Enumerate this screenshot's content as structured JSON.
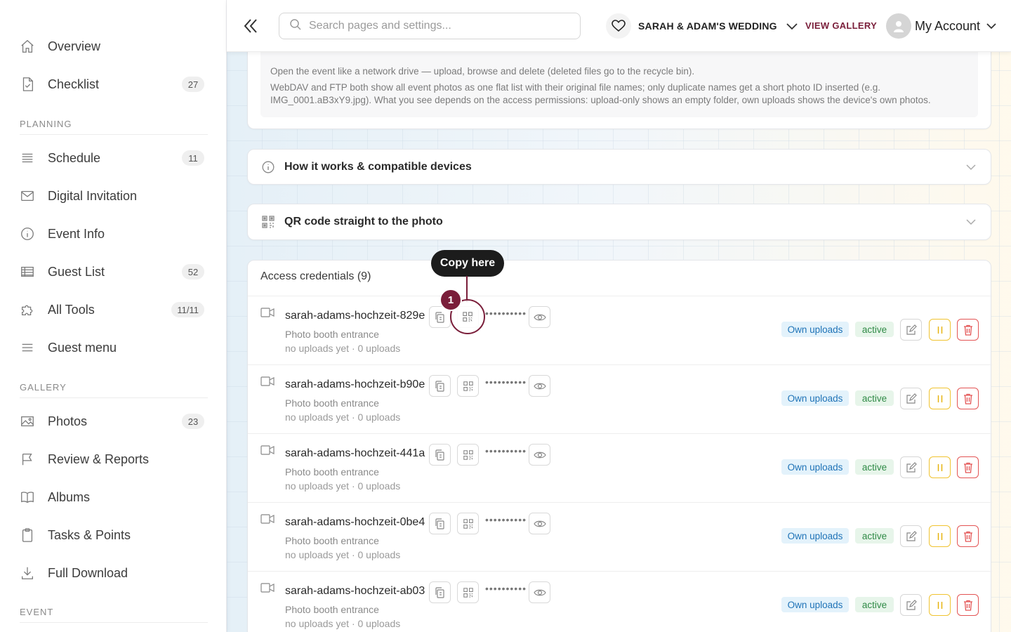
{
  "sidebar": {
    "items": [
      {
        "label": "Overview",
        "icon": "home-icon",
        "count": ""
      },
      {
        "label": "Checklist",
        "icon": "checklist-icon",
        "count": "27"
      },
      {
        "label": "Schedule",
        "icon": "schedule-icon",
        "count": "11"
      },
      {
        "label": "Digital Invitation",
        "icon": "envelope-icon",
        "count": ""
      },
      {
        "label": "Event Info",
        "icon": "info-icon",
        "count": ""
      },
      {
        "label": "Guest List",
        "icon": "table-icon",
        "count": "52"
      },
      {
        "label": "All Tools",
        "icon": "puzzle-icon",
        "count": "11/11"
      },
      {
        "label": "Guest menu",
        "icon": "menu-icon",
        "count": ""
      },
      {
        "label": "Photos",
        "icon": "image-icon",
        "count": "23"
      },
      {
        "label": "Review & Reports",
        "icon": "flag-icon",
        "count": ""
      },
      {
        "label": "Albums",
        "icon": "book-icon",
        "count": ""
      },
      {
        "label": "Tasks & Points",
        "icon": "clipboard-icon",
        "count": ""
      },
      {
        "label": "Full Download",
        "icon": "download-icon",
        "count": ""
      }
    ],
    "sections": {
      "planning": "PLANNING",
      "gallery": "GALLERY",
      "event": "EVENT"
    }
  },
  "topbar": {
    "search_placeholder": "Search pages and settings...",
    "event_name": "SARAH & ADAM'S WEDDING",
    "view_gallery": "VIEW GALLERY",
    "account_label": "My Account"
  },
  "network_drive": {
    "line1": "Open the event like a network drive — upload, browse and delete (deleted files go to the recycle bin).",
    "line2": "WebDAV and FTP both show all event photos as one flat list with their original file names; only duplicate names get a short photo ID inserted (e.g. IMG_0001.aB3xY9.jpg). What you see depends on the access permissions: upload-only shows an empty folder, own uploads shows the device's own photos."
  },
  "accordions": {
    "how_it_works": "How it works & compatible devices",
    "qr_code": "QR code straight to the photo"
  },
  "credentials": {
    "header": "Access credentials (9)",
    "rows": [
      {
        "name": "sarah-adams-hochzeit-829e",
        "location": "Photo booth entrance",
        "meta": "no uploads yet · 0 uploads",
        "password_mask": "••••••••••",
        "permission": "Own uploads",
        "status": "active"
      },
      {
        "name": "sarah-adams-hochzeit-b90e",
        "location": "Photo booth entrance",
        "meta": "no uploads yet · 0 uploads",
        "password_mask": "••••••••••",
        "permission": "Own uploads",
        "status": "active"
      },
      {
        "name": "sarah-adams-hochzeit-441a",
        "location": "Photo booth entrance",
        "meta": "no uploads yet · 0 uploads",
        "password_mask": "••••••••••",
        "permission": "Own uploads",
        "status": "active"
      },
      {
        "name": "sarah-adams-hochzeit-0be4",
        "location": "Photo booth entrance",
        "meta": "no uploads yet · 0 uploads",
        "password_mask": "••••••••••",
        "permission": "Own uploads",
        "status": "active"
      },
      {
        "name": "sarah-adams-hochzeit-ab03",
        "location": "Photo booth entrance",
        "meta": "no uploads yet · 0 uploads",
        "password_mask": "••••••••••",
        "permission": "Own uploads",
        "status": "active"
      }
    ]
  },
  "tutorial": {
    "tooltip": "Copy here",
    "step": "1"
  },
  "colors": {
    "accent": "#7a1e3a",
    "permission_tag": "#1f73b7",
    "status_tag": "#2f8a46",
    "pause": "#e5b000",
    "delete": "#e35454"
  }
}
